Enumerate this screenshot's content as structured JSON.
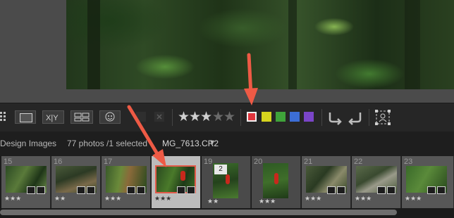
{
  "toolbar": {
    "stars": [
      "★",
      "★",
      "★",
      "★",
      "★"
    ],
    "rating_filled": 3,
    "color_labels": [
      "#e0353d",
      "#d6d41e",
      "#3fa33a",
      "#3c6ed6",
      "#7a45c8"
    ],
    "icons": [
      "grid-view-icon",
      "loupe-view-icon",
      "compare-view-icon",
      "survey-view-icon",
      "people-view-icon",
      "flag-icon",
      "reject-flag-icon",
      "rotate-left-icon",
      "rotate-right-icon",
      "crop-overlay-icon"
    ]
  },
  "filmstrip_header": {
    "collection": "Design Images",
    "count": "77 photos /1 selected",
    "filename": "MG_7613.CR2",
    "dropdown_glyph": "▼"
  },
  "filmstrip": {
    "cells": [
      {
        "num": "15",
        "stars": "★★★"
      },
      {
        "num": "16",
        "stars": "★★"
      },
      {
        "num": "17",
        "stars": "★★★"
      },
      {
        "num": "",
        "stars": "★★★",
        "selected": true
      },
      {
        "num": "19",
        "stars": "★★",
        "stack": "2"
      },
      {
        "num": "20",
        "stars": "★★★"
      },
      {
        "num": "21",
        "stars": "★★★"
      },
      {
        "num": "22",
        "stars": "★★★"
      },
      {
        "num": "23",
        "stars": "★★★"
      }
    ]
  },
  "colors": {
    "arrow": "#ee5a45",
    "selection": "#e35a4a"
  }
}
